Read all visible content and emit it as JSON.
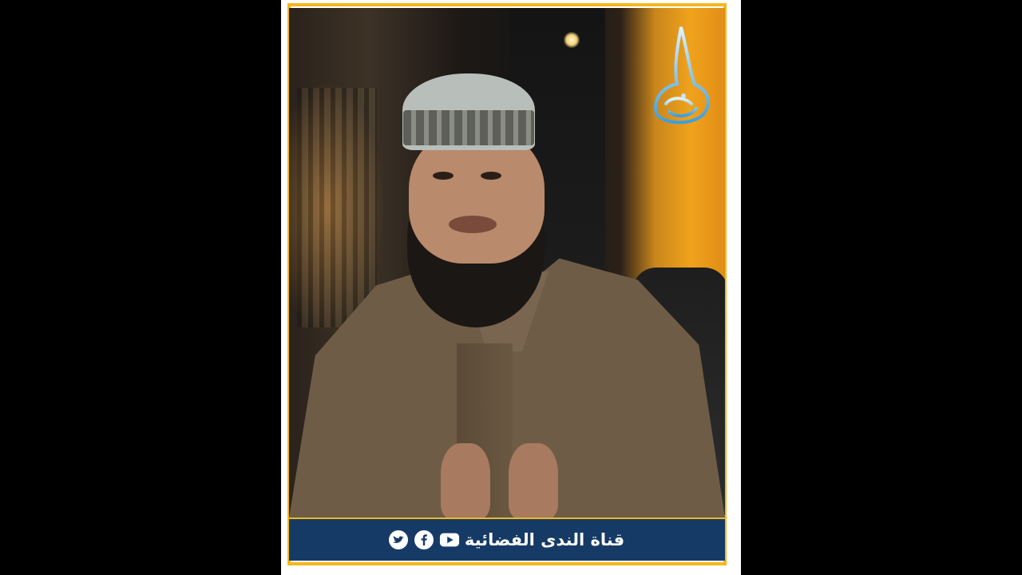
{
  "video": {
    "channel_name": "قناة الندى الفضائية",
    "logo_text": "الندى",
    "social_icons": [
      "twitter-icon",
      "facebook-icon",
      "youtube-icon"
    ]
  },
  "colors": {
    "frame_border": "#f4b81c",
    "banner_background": "#163a66",
    "banner_text": "#ffffff",
    "page_background": "#000000"
  }
}
